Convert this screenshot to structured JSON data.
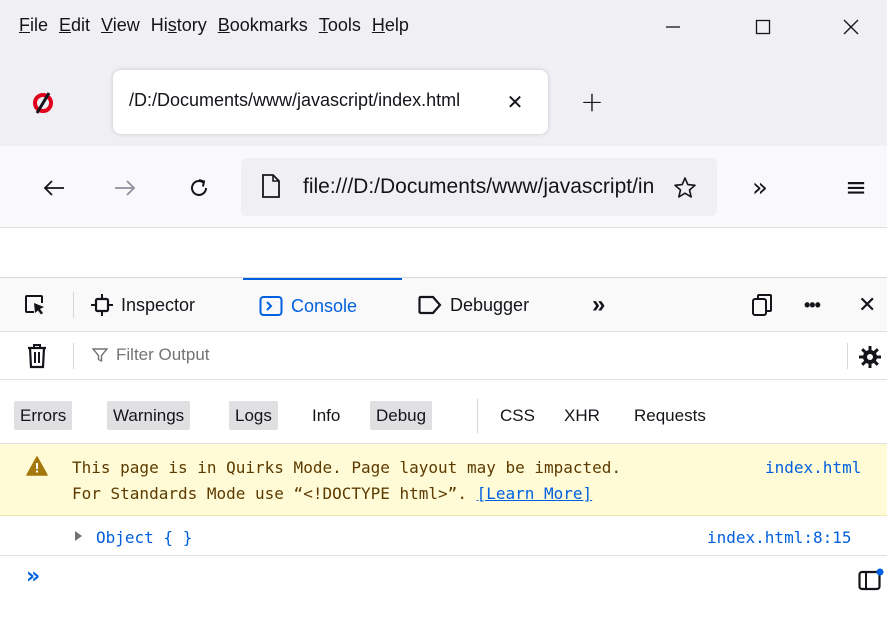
{
  "menubar": {
    "items": [
      {
        "pre": "",
        "u": "F",
        "post": "ile"
      },
      {
        "pre": "",
        "u": "E",
        "post": "dit"
      },
      {
        "pre": "",
        "u": "V",
        "post": "iew"
      },
      {
        "pre": "Hi",
        "u": "s",
        "post": "tory"
      },
      {
        "pre": "",
        "u": "B",
        "post": "ookmarks"
      },
      {
        "pre": "",
        "u": "T",
        "post": "ools"
      },
      {
        "pre": "",
        "u": "H",
        "post": "elp"
      }
    ]
  },
  "tabbar": {
    "active_tab_title": "/D:/Documents/www/javascript/index.html",
    "close_glyph": "✕",
    "new_tab_glyph": "+"
  },
  "navbar": {
    "url": "file:///D:/Documents/www/javascript/index.html",
    "overflow_glyph": "»",
    "menu_glyph": "≡"
  },
  "devtools": {
    "tabs": {
      "inspector": "Inspector",
      "console": "Console",
      "debugger": "Debugger",
      "more_glyph": "»"
    },
    "more_options_glyph": "•••",
    "close_glyph": "✕",
    "filter_placeholder": "Filter Output",
    "levels": {
      "errors": "Errors",
      "warnings": "Warnings",
      "logs": "Logs",
      "info": "Info",
      "debug": "Debug",
      "css": "CSS",
      "xhr": "XHR",
      "requests": "Requests"
    },
    "warning": {
      "line1": "This page is in Quirks Mode. Page layout may be impacted.",
      "line2_prefix": "For Standards Mode use “<!DOCTYPE html>”. ",
      "learn_more": "[Learn More]",
      "source": "index.html"
    },
    "log": {
      "text": "Object {  }",
      "source": "index.html:8:15"
    },
    "prompt_glyph": "»"
  },
  "colors": {
    "accent": "#0060df",
    "warning_bg": "#fffbd6",
    "chrome_bg": "#f0f0f4"
  }
}
